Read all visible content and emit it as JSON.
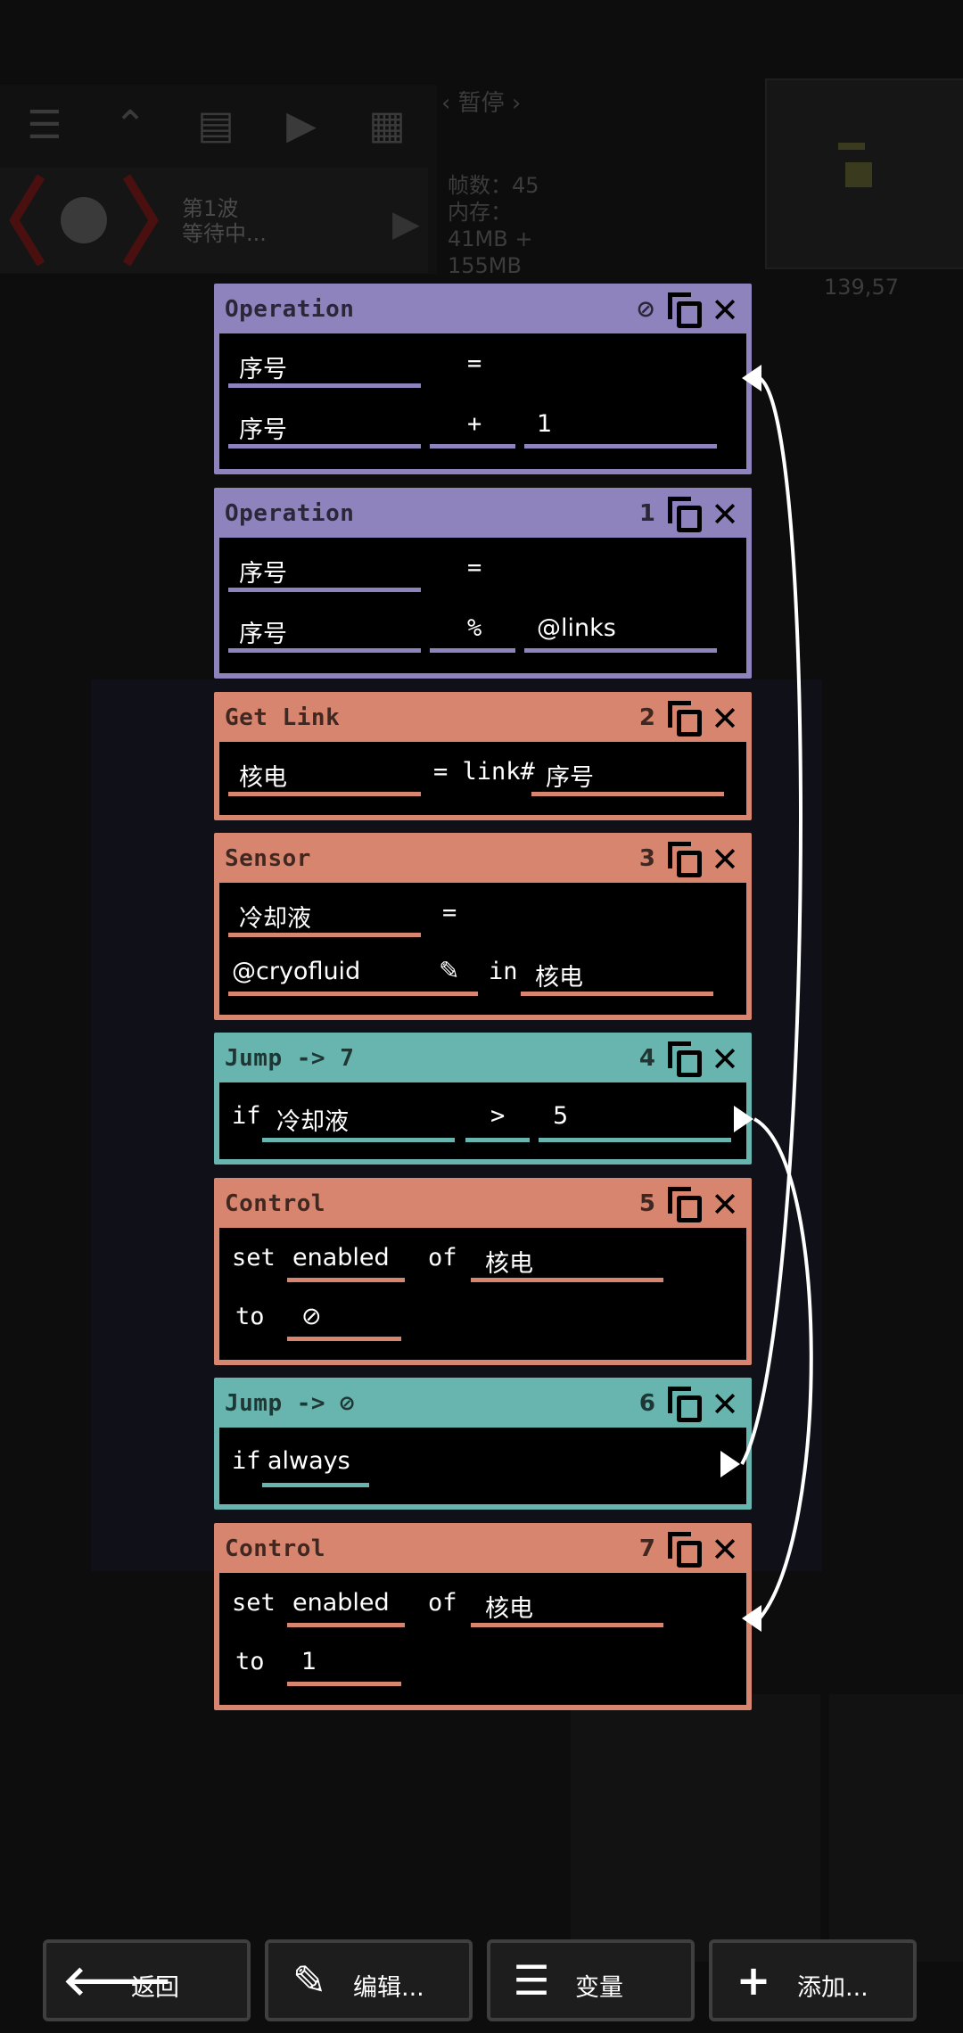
{
  "hud": {
    "status": "‹ 暂停 ›",
    "wave_line1": "第1波",
    "wave_line2": "等待中...",
    "stats_line1": "帧数：45",
    "stats_line2": "内存：",
    "stats_line3": " 41MB +",
    "stats_line4": " 155MB",
    "coords": "139,57"
  },
  "instructions": [
    {
      "title": "Operation",
      "index": "⊘",
      "fields": [
        "序号",
        "=",
        "序号",
        "+",
        "1"
      ]
    },
    {
      "title": "Operation",
      "index": "1",
      "fields": [
        "序号",
        "=",
        "序号",
        "%",
        "@links"
      ]
    },
    {
      "title": "Get Link",
      "index": "2",
      "fields": [
        "核电",
        "= link#",
        "序号"
      ]
    },
    {
      "title": "Sensor",
      "index": "3",
      "fields": [
        "冷却液",
        "=",
        "@cryofluid",
        "in",
        "核电"
      ]
    },
    {
      "title": "Jump -> 7",
      "index": "4",
      "fields": [
        "if",
        "冷却液",
        ">",
        "5"
      ]
    },
    {
      "title": "Control",
      "index": "5",
      "fields": [
        "set",
        "enabled",
        "of",
        "核电",
        "to",
        "⊘"
      ]
    },
    {
      "title": "Jump -> ⊘",
      "index": "6",
      "fields": [
        "if",
        "always"
      ]
    },
    {
      "title": "Control",
      "index": "7",
      "fields": [
        "set",
        "enabled",
        "of",
        "核电",
        "to",
        "1"
      ]
    }
  ],
  "bottom_bar": {
    "back": "返回",
    "edit": "编辑...",
    "variables": "变量",
    "add": "添加..."
  },
  "colors": {
    "operation": "#8f83bd",
    "io": "#d88570",
    "flow": "#67b5ae"
  }
}
